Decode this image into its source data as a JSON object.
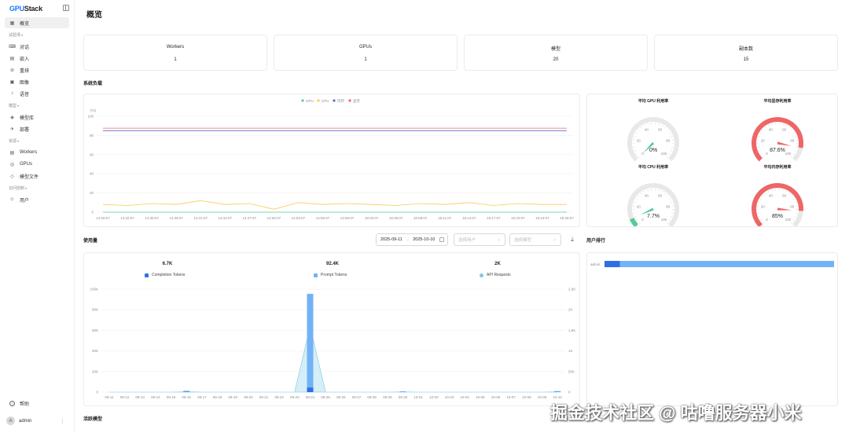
{
  "app": {
    "logo_prefix": "GPU",
    "logo_suffix": "Stack"
  },
  "sidebar": {
    "overview": "概览",
    "group_playground": "试验场",
    "playground_items": [
      "对话",
      "嵌入",
      "重排",
      "图像",
      "语音"
    ],
    "group_models": "模型",
    "model_items": [
      "模型库",
      "部署"
    ],
    "group_resources": "资源",
    "resource_items": [
      "Workers",
      "GPUs",
      "模型文件"
    ],
    "group_access": "访问控制",
    "access_items": [
      "用户"
    ],
    "help": "帮助",
    "user": "admin",
    "user_initial": "A"
  },
  "page": {
    "title": "概览"
  },
  "stats": [
    {
      "label": "Workers",
      "value": "1"
    },
    {
      "label": "GPUs",
      "value": "1"
    },
    {
      "label": "模型",
      "value": "20"
    },
    {
      "label": "副本数",
      "value": "15"
    }
  ],
  "system_load": {
    "title": "系统负载",
    "unit": "(%)",
    "legend": [
      "GPU",
      "CPU",
      "内存",
      "显存"
    ],
    "legend_colors": [
      "#54cc98",
      "#fac858",
      "#5470c6",
      "#ee6666"
    ],
    "yticks": [
      "100",
      "80",
      "60",
      "40",
      "20",
      "0"
    ],
    "xticks": [
      "14:29:07",
      "14:32:07",
      "14:35:07",
      "14:38:07",
      "14:41:07",
      "14:44:07",
      "14:47:07",
      "14:50:07",
      "14:53:07",
      "14:56:07",
      "14:59:07",
      "15:02:07",
      "15:05:07",
      "15:08:07",
      "15:11:07",
      "15:14:07",
      "15:17:07",
      "15:20:07",
      "15:23:07",
      "15:26:07"
    ]
  },
  "gauges": [
    {
      "title": "平均 GPU 利用率",
      "value": "0%",
      "level": 0,
      "color": "#54cc98"
    },
    {
      "title": "平均显存利用率",
      "value": "87.6%",
      "level": 87.6,
      "color": "#ee6666"
    },
    {
      "title": "平均 CPU 利用率",
      "value": "7.7%",
      "level": 7.7,
      "color": "#54cc98"
    },
    {
      "title": "平均内存利用率",
      "value": "85%",
      "level": 85,
      "color": "#ee6666"
    }
  ],
  "gauge_ticks": [
    "0",
    "20",
    "40",
    "60",
    "80",
    "100"
  ],
  "usage": {
    "title": "使用量",
    "date_start": "2025-09-11",
    "date_end": "2025-10-10",
    "select_user_placeholder": "选择用户",
    "select_model_placeholder": "选择模型",
    "totals": [
      {
        "value": "6.7K",
        "label": "Completion Tokens",
        "color": "#2f6fe4"
      },
      {
        "value": "92.4K",
        "label": "Prompt Tokens",
        "color": "#73b2f5"
      },
      {
        "value": "2K",
        "label": "API Requests",
        "color": "#7cc8e8"
      }
    ],
    "yticks_left": [
      "100K",
      "80K",
      "60K",
      "40K",
      "20K",
      "0"
    ],
    "yticks_right": [
      "2.5K",
      "2K",
      "1.5K",
      "1K",
      "500",
      "0"
    ]
  },
  "user_rank": {
    "title": "用户排行",
    "user": "admin"
  },
  "active_models": {
    "title": "活跃模型"
  },
  "watermark": "掘金技术社区 @ 咕噜服务器小米",
  "chart_data": [
    {
      "type": "line",
      "title": "系统负载",
      "ylabel": "(%)",
      "ylim": [
        0,
        100
      ],
      "x": [
        "14:29:07",
        "14:32:07",
        "14:35:07",
        "14:38:07",
        "14:41:07",
        "14:44:07",
        "14:47:07",
        "14:50:07",
        "14:53:07",
        "14:56:07",
        "14:59:07",
        "15:02:07",
        "15:05:07",
        "15:08:07",
        "15:11:07",
        "15:14:07",
        "15:17:07",
        "15:20:07",
        "15:23:07",
        "15:26:07"
      ],
      "series": [
        {
          "name": "GPU",
          "values": [
            0,
            0,
            0,
            0,
            0,
            0,
            0,
            0,
            0,
            0,
            0,
            0,
            0,
            0,
            0,
            0,
            0,
            0,
            0,
            0
          ]
        },
        {
          "name": "CPU",
          "values": [
            8,
            7,
            9,
            8,
            12,
            8,
            9,
            3,
            10,
            8,
            9,
            8,
            7,
            9,
            8,
            10,
            7,
            9,
            8,
            8
          ]
        },
        {
          "name": "内存",
          "values": [
            85,
            85,
            85,
            85,
            85,
            85,
            85,
            85,
            85,
            85,
            85,
            85,
            85,
            85,
            85,
            85,
            85,
            85,
            85,
            85
          ]
        },
        {
          "name": "显存",
          "values": [
            87.6,
            87.6,
            87.6,
            87.6,
            87.6,
            87.6,
            87.6,
            87.6,
            87.6,
            87.6,
            87.6,
            87.6,
            87.6,
            87.6,
            87.6,
            87.6,
            87.6,
            87.6,
            87.6,
            87.6
          ]
        }
      ],
      "legend": "top-center",
      "grid": true
    },
    {
      "type": "bar",
      "title": "使用量",
      "categories": [
        "09-11",
        "09-12",
        "09-13",
        "09-14",
        "09-15",
        "09-16",
        "09-17",
        "09-18",
        "09-19",
        "09-20",
        "09-21",
        "09-22",
        "09-23",
        "09-24",
        "09-25",
        "09-26",
        "09-27",
        "09-28",
        "09-29",
        "09-30",
        "10-01",
        "10-02",
        "10-03",
        "10-04",
        "10-05",
        "10-06",
        "10-07",
        "10-08",
        "10-09",
        "10-10"
      ],
      "ylim": [
        0,
        100000
      ],
      "y2lim": [
        0,
        2500
      ],
      "series": [
        {
          "name": "Completion Tokens",
          "values": [
            0,
            0,
            0,
            0,
            0,
            300,
            0,
            0,
            0,
            0,
            0,
            0,
            0,
            4500,
            0,
            0,
            0,
            0,
            0,
            200,
            0,
            0,
            0,
            0,
            0,
            0,
            0,
            0,
            0,
            300
          ]
        },
        {
          "name": "Prompt Tokens",
          "values": [
            0,
            0,
            0,
            0,
            0,
            1000,
            0,
            0,
            0,
            0,
            0,
            0,
            0,
            91000,
            0,
            0,
            0,
            0,
            0,
            500,
            0,
            0,
            0,
            0,
            0,
            0,
            0,
            0,
            0,
            700
          ]
        },
        {
          "name": "API Requests",
          "values": [
            0,
            0,
            0,
            0,
            0,
            10,
            0,
            0,
            0,
            0,
            0,
            0,
            0,
            1600,
            0,
            0,
            0,
            0,
            0,
            5,
            0,
            0,
            0,
            0,
            0,
            0,
            0,
            0,
            0,
            10
          ]
        }
      ],
      "grid": true
    },
    {
      "type": "bar",
      "title": "用户排行",
      "categories": [
        "admin"
      ],
      "series": [
        {
          "name": "Completion Tokens",
          "values": [
            6700
          ]
        },
        {
          "name": "Prompt Tokens",
          "values": [
            92400
          ]
        }
      ]
    }
  ]
}
